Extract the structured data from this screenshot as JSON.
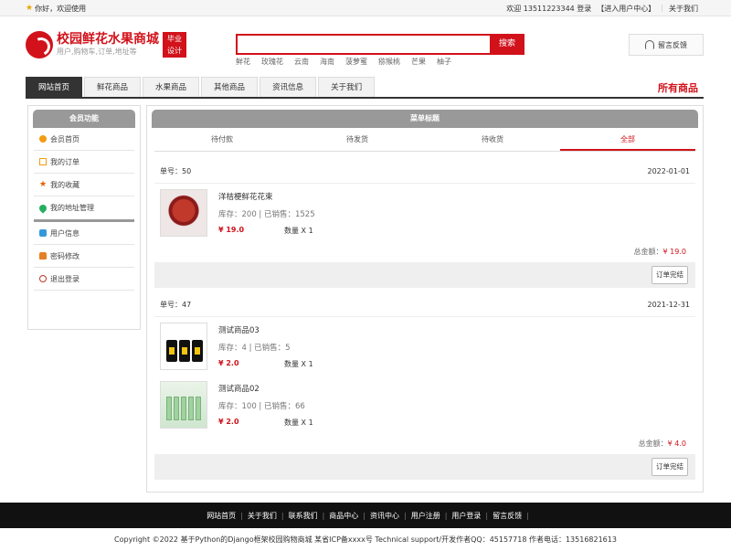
{
  "topbar": {
    "greeting": "你好，欢迎使用",
    "welcome": "欢迎 13511223344 登录",
    "user_center": "【进入用户中心】",
    "about": "关于我们"
  },
  "header": {
    "site_title": "校园鲜花水果商城",
    "slogan": "用户,购物车,订单,地址等",
    "badge_line1": "毕业",
    "badge_line2": "设计",
    "search_button": "搜索",
    "hot_keywords": [
      "鲜花",
      "玫瑰花",
      "云南",
      "海南",
      "菠萝蜜",
      "猕猴桃",
      "芒果",
      "柚子"
    ],
    "feedback": "留言反馈"
  },
  "nav": {
    "tabs": [
      "网站首页",
      "鲜花商品",
      "水果商品",
      "其他商品",
      "资讯信息",
      "关于我们"
    ],
    "active": "网站首页",
    "all_goods": "所有商品"
  },
  "sidebar": {
    "title": "会员功能",
    "group1": [
      "会员首页",
      "我的订单",
      "我的收藏",
      "我的地址管理"
    ],
    "group2": [
      "用户信息",
      "密码修改",
      "退出登录"
    ]
  },
  "main": {
    "title": "菜单标题",
    "tabs": [
      "待付款",
      "待发货",
      "待收货",
      "全部"
    ],
    "active_tab": "全部",
    "orders": [
      {
        "no": "单号：50",
        "date": "2022-01-01",
        "items": [
          {
            "name": "洋桔梗鲜花花束",
            "stock": "库存：200 | 已销售：1525",
            "price": "¥ 19.0",
            "qty": "数量 X 1"
          }
        ],
        "total_label": "总金额：",
        "total": "¥ 19.0",
        "action": "订单完结"
      },
      {
        "no": "单号：47",
        "date": "2021-12-31",
        "items": [
          {
            "name": "测试商品03",
            "stock": "库存：4 | 已销售：5",
            "price": "¥ 2.0",
            "qty": "数量 X 1"
          },
          {
            "name": "测试商品02",
            "stock": "库存：100 | 已销售：66",
            "price": "¥ 2.0",
            "qty": "数量 X 1"
          }
        ],
        "total_label": "总金额：",
        "total": "¥ 4.0",
        "action": "订单完结"
      }
    ]
  },
  "footer": {
    "links": [
      "网站首页",
      "关于我们",
      "联系我们",
      "商品中心",
      "资讯中心",
      "用户注册",
      "用户登录",
      "留言反馈"
    ],
    "copyright": "Copyright ©2022 基于Python的Django框架校园购物商城 某省ICP备xxxx号    Technical support/开发作者QQ：45157718    作者电话：13516821613"
  },
  "colors": {
    "brand": "#d2121b",
    "nav_active": "#333333"
  }
}
